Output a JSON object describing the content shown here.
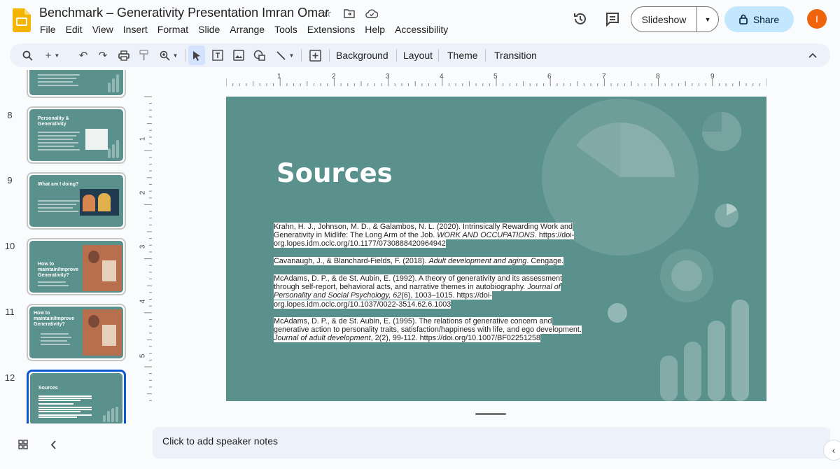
{
  "header": {
    "doc_title": "Benchmark – Generativity Presentation Imran Omar",
    "menu": [
      "File",
      "Edit",
      "View",
      "Insert",
      "Format",
      "Slide",
      "Arrange",
      "Tools",
      "Extensions",
      "Help",
      "Accessibility"
    ],
    "slideshow_label": "Slideshow",
    "share_label": "Share",
    "avatar_initial": "I"
  },
  "toolbar": {
    "background_label": "Background",
    "layout_label": "Layout",
    "theme_label": "Theme",
    "transition_label": "Transition"
  },
  "filmstrip": {
    "slides": [
      {
        "number": "8",
        "title": "Personality & Generativity"
      },
      {
        "number": "9",
        "title": "What am I doing?"
      },
      {
        "number": "10",
        "title": "How to maintain/Improve Generativity?"
      },
      {
        "number": "11",
        "title": "How to maintain/Improve Generativity?"
      },
      {
        "number": "12",
        "title": "Sources"
      }
    ]
  },
  "rulers": {
    "horizontal": [
      "1",
      "2",
      "3",
      "4",
      "5",
      "6",
      "7",
      "8",
      "9"
    ],
    "vertical": [
      "1",
      "2",
      "3",
      "4",
      "5"
    ]
  },
  "slide": {
    "title": "Sources",
    "references": [
      {
        "pre": "Krahn, H. J., Johnson, M. D., & Galambos, N. L. (2020). Intrinsically Rewarding Work and Generativity in Midlife: The Long Arm of the Job. ",
        "italic": "WORK AND OCCUPATIONS",
        "post": ". https://doi-org.lopes.idm.oclc.org/10.1177/0730888420964942"
      },
      {
        "pre": "Cavanaugh, J., & Blanchard-Fields, F. (2018). ",
        "italic": "Adult development and aging",
        "post": ". Cengage."
      },
      {
        "pre": "McAdams, D. P., & de St. Aubin, E. (1992). A theory of generativity and its assessment through self-report, behavioral acts, and narrative themes in autobiography. ",
        "italic": "Journal of Personality and Social Psychology, 62",
        "post": "(6), 1003–1015. https://doi-org.lopes.idm.oclc.org/10.1037/0022-3514.62.6.1003"
      },
      {
        "pre": "McAdams, D. P., & de St. Aubin, E. (1995). The relations of generative concern and generative action to personality traits, satisfaction/happiness with life, and ego development. ",
        "italic": "Journal of adult development",
        "post": ", 2(2), 99-112. https://doi.org/10.1007/BF02251258"
      }
    ]
  },
  "notes": {
    "placeholder": "Click to add speaker notes"
  },
  "colors": {
    "slide_bg": "#5a918d",
    "accent": "#0b57d0",
    "share_bg": "#c2e7ff"
  }
}
